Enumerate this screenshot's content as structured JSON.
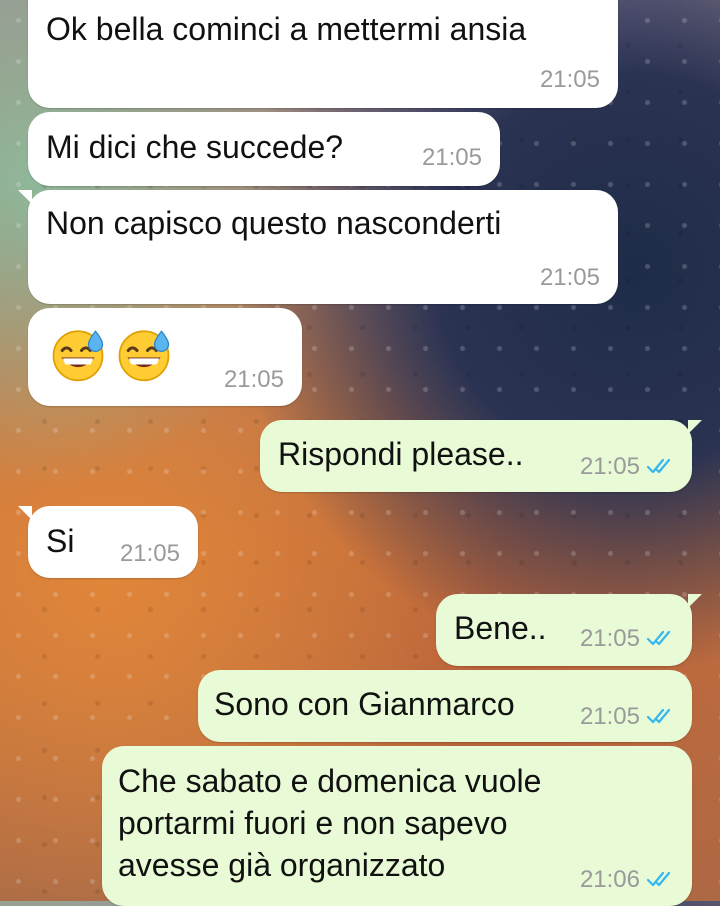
{
  "chat": {
    "messages": [
      {
        "direction": "incoming",
        "text": "Ok bella cominci a mettermi ansia",
        "time": "21:05"
      },
      {
        "direction": "incoming",
        "text": "Mi dici che succede?",
        "time": "21:05"
      },
      {
        "direction": "incoming",
        "text": "Non capisco questo nasconderti",
        "time": "21:05"
      },
      {
        "direction": "incoming",
        "emoji": [
          "grinning-sweat-emoji",
          "grinning-sweat-emoji"
        ],
        "time": "21:05"
      },
      {
        "direction": "outgoing",
        "text": "Rispondi please..",
        "time": "21:05",
        "status": "read"
      },
      {
        "direction": "incoming",
        "text": "Si",
        "time": "21:05"
      },
      {
        "direction": "outgoing",
        "text": "Bene..",
        "time": "21:05",
        "status": "read"
      },
      {
        "direction": "outgoing",
        "text": "Sono con Gianmarco",
        "time": "21:05",
        "status": "read"
      },
      {
        "direction": "outgoing",
        "text": "Che sabato e domenica vuole\nportarmi fuori e non sapevo\navesse già organizzato",
        "time": "21:06",
        "status": "read"
      }
    ]
  },
  "colors": {
    "incoming_bubble": "#ffffff",
    "outgoing_bubble": "#e8fad6",
    "read_ticks": "#34b7f1",
    "timestamp": "#9a9a9a"
  }
}
